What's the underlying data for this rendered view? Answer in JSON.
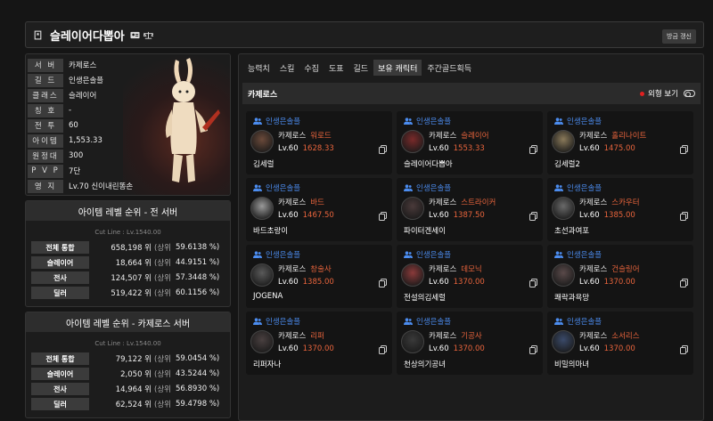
{
  "header": {
    "name": "슬레이어다뽑아",
    "refresh_label": "방금 갱신"
  },
  "profile": {
    "rows": [
      {
        "key": "서 버",
        "value": "카제로스"
      },
      {
        "key": "길 드",
        "value": "인생은솔플"
      },
      {
        "key": "클래스",
        "value": "슬레이어"
      },
      {
        "key": "칭 호",
        "value": "-"
      },
      {
        "key": "전 투",
        "value": "60"
      },
      {
        "key": "아이템",
        "value": "1,553.33"
      },
      {
        "key": "원정대",
        "value": "300"
      },
      {
        "key": "P V P",
        "value": "7단"
      },
      {
        "key": "영 지",
        "value": "Lv.70 신이내린똥손"
      }
    ]
  },
  "rank_all": {
    "title": "아이템 레벨 순위 - 전 서버",
    "cutline": "Cut Line : Lv.1540.00",
    "rows": [
      {
        "key": "전체 통합",
        "pos": "658,198 위",
        "sub": "(상위",
        "pct": "59.6138 %)"
      },
      {
        "key": "슬레이어",
        "pos": "18,664 위",
        "sub": "(상위",
        "pct": "44.9151 %)"
      },
      {
        "key": "전사",
        "pos": "124,507 위",
        "sub": "(상위",
        "pct": "57.3448 %)"
      },
      {
        "key": "딜러",
        "pos": "519,422 위",
        "sub": "(상위",
        "pct": "60.1156 %)"
      }
    ]
  },
  "rank_server": {
    "title": "아이템 레벨 순위 - 카제로스 서버",
    "cutline": "Cut Line : Lv.1540.00",
    "rows": [
      {
        "key": "전체 통합",
        "pos": "79,122 위",
        "sub": "(상위",
        "pct": "59.0454 %)"
      },
      {
        "key": "슬레이어",
        "pos": "2,050 위",
        "sub": "(상위",
        "pct": "43.5244 %)"
      },
      {
        "key": "전사",
        "pos": "14,964 위",
        "sub": "(상위",
        "pct": "56.8930 %)"
      },
      {
        "key": "딜러",
        "pos": "62,524 위",
        "sub": "(상위",
        "pct": "59.4798 %)"
      }
    ]
  },
  "tabs": [
    {
      "label": "능력치",
      "active": false
    },
    {
      "label": "스킬",
      "active": false
    },
    {
      "label": "수집",
      "active": false
    },
    {
      "label": "도표",
      "active": false
    },
    {
      "label": "길드",
      "active": false
    },
    {
      "label": "보유 캐릭터",
      "active": true
    },
    {
      "label": "주간골드획득",
      "active": false
    }
  ],
  "server_bar": {
    "name": "카제로스",
    "look_label": "외형 보기"
  },
  "colors": {
    "guild": "#4c8df0",
    "accent": "#e8643c",
    "dot": "#e02020"
  },
  "characters": [
    {
      "guild": "인생은솔플",
      "server": "카제로스",
      "class": "워로드",
      "lv": "Lv.60",
      "ilvl": "1628.33",
      "name": "김세럴",
      "tint": "#6b4a3a"
    },
    {
      "guild": "인생은솔플",
      "server": "카제로스",
      "class": "슬레이어",
      "lv": "Lv.60",
      "ilvl": "1553.33",
      "name": "슬레이어다뽑아",
      "tint": "#7a2a2a"
    },
    {
      "guild": "인생은솔플",
      "server": "카제로스",
      "class": "홀리나이트",
      "lv": "Lv.60",
      "ilvl": "1475.00",
      "name": "김세럴2",
      "tint": "#8a7a5a"
    },
    {
      "guild": "인생은솔플",
      "server": "카제로스",
      "class": "바드",
      "lv": "Lv.60",
      "ilvl": "1467.50",
      "name": "바드초랑이",
      "tint": "#9a9a9a"
    },
    {
      "guild": "인생은솔플",
      "server": "카제로스",
      "class": "스트라이커",
      "lv": "Lv.60",
      "ilvl": "1387.50",
      "name": "파이터겐세이",
      "tint": "#4a3a3a"
    },
    {
      "guild": "인생은솔플",
      "server": "카제로스",
      "class": "스카우터",
      "lv": "Lv.60",
      "ilvl": "1385.00",
      "name": "초선과여포",
      "tint": "#6a6a6a"
    },
    {
      "guild": "인생은솔플",
      "server": "카제로스",
      "class": "창술사",
      "lv": "Lv.60",
      "ilvl": "1385.00",
      "name": "JOGENA",
      "tint": "#5a5a5a"
    },
    {
      "guild": "인생은솔플",
      "server": "카제로스",
      "class": "데모닉",
      "lv": "Lv.60",
      "ilvl": "1370.00",
      "name": "전설의김세럴",
      "tint": "#8a3a3a"
    },
    {
      "guild": "인생은솔플",
      "server": "카제로스",
      "class": "건슬링어",
      "lv": "Lv.60",
      "ilvl": "1370.00",
      "name": "쾌락과욕망",
      "tint": "#5a4a4a"
    },
    {
      "guild": "인생은솔플",
      "server": "카제로스",
      "class": "리퍼",
      "lv": "Lv.60",
      "ilvl": "1370.00",
      "name": "리퍼자나",
      "tint": "#4a4040"
    },
    {
      "guild": "인생은솔플",
      "server": "카제로스",
      "class": "기공사",
      "lv": "Lv.60",
      "ilvl": "1370.00",
      "name": "천상의기공녀",
      "tint": "#3a3a3a"
    },
    {
      "guild": "인생은솔플",
      "server": "카제로스",
      "class": "소서리스",
      "lv": "Lv.60",
      "ilvl": "1370.00",
      "name": "비밀의마녀",
      "tint": "#3a4a6a"
    }
  ]
}
